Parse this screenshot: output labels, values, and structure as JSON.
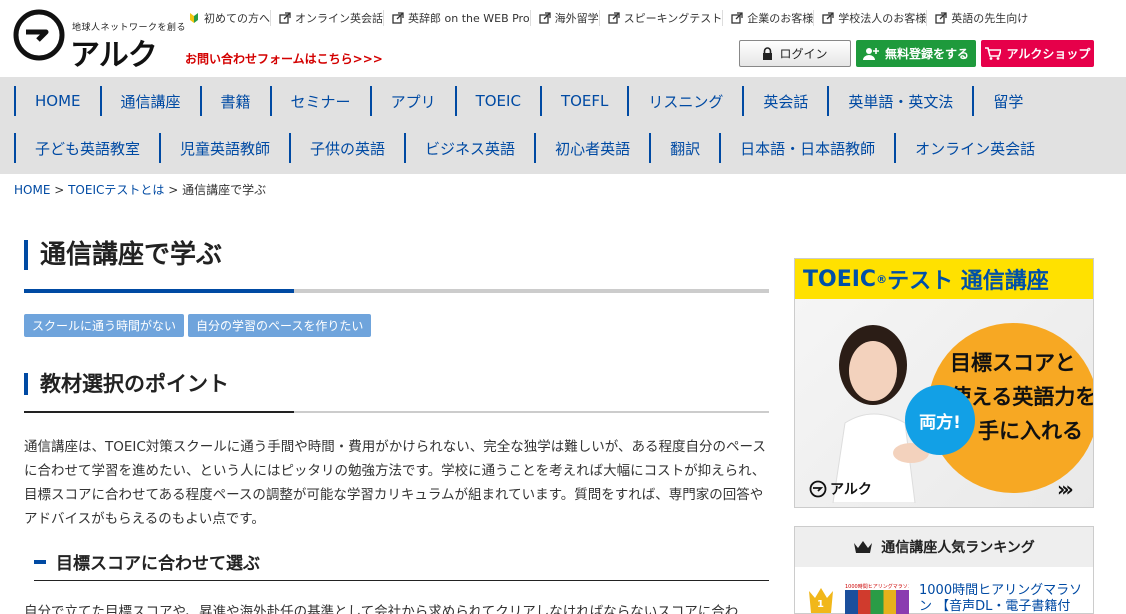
{
  "header": {
    "tagline": "地球人ネットワークを創る",
    "brand": "アルク",
    "contact_link": "お問い合わせフォームはこちら>>>",
    "toplinks": [
      {
        "label": "初めての方へ",
        "icon": "beginner-icon"
      },
      {
        "label": "オンライン英会話",
        "icon": "external-link-icon"
      },
      {
        "label": "英辞郎 on the WEB Pro",
        "icon": "external-link-icon"
      },
      {
        "label": "海外留学",
        "icon": "external-link-icon"
      },
      {
        "label": "スピーキングテスト",
        "icon": "external-link-icon"
      },
      {
        "label": "企業のお客様",
        "icon": "external-link-icon"
      },
      {
        "label": "学校法人のお客様",
        "icon": "external-link-icon"
      },
      {
        "label": "英語の先生向け",
        "icon": "external-link-icon"
      }
    ],
    "login_label": "ログイン",
    "register_label": "無料登録をする",
    "shop_label": "アルクショップ"
  },
  "nav": {
    "row1": [
      "HOME",
      "通信講座",
      "書籍",
      "セミナー",
      "アプリ",
      "TOEIC",
      "TOEFL",
      "リスニング",
      "英会話",
      "英単語・英文法",
      "留学"
    ],
    "row2": [
      "子ども英語教室",
      "児童英語教師",
      "子供の英語",
      "ビジネス英語",
      "初心者英語",
      "翻訳",
      "日本語・日本語教師",
      "オンライン英会話"
    ]
  },
  "breadcrumb": {
    "home": "HOME",
    "sep1": " > ",
    "parent": "TOEICテストとは",
    "sep2": " > ",
    "current": "通信講座で学ぶ"
  },
  "main": {
    "title": "通信講座で学ぶ",
    "tags": [
      "スクールに通う時間がない",
      "自分の学習のペースを作りたい"
    ],
    "section_title": "教材選択のポイント",
    "paragraph": "通信講座は、TOEIC対策スクールに通う手間や時間・費用がかけられない、完全な独学は難しいが、ある程度自分のペースに合わせて学習を進めたい、という人にはピッタリの勉強方法です。学校に通うことを考えれば大幅にコストが抑えられ、目標スコアに合わせてある程度ペースの調整が可能な学習カリキュラムが組まれています。質問をすれば、専門家の回答やアドバイスがもらえるのもよい点です。",
    "subsection_title": "目標スコアに合わせて選ぶ",
    "paragraph2": "自分で立てた目標スコアや、昇進や海外赴任の基準として会社から求められてクリアしなければならないスコアに合わ"
  },
  "sidebar": {
    "banner": {
      "title_main": "TOEIC",
      "title_reg": "®",
      "title_rest": " テスト 通信講座",
      "line1": "目標スコアと",
      "line2": "使える英語力を",
      "line3": "手に入れる",
      "badge": "両方!",
      "logo": "アルク",
      "arrow": "›››"
    },
    "ranking": {
      "heading": "通信講座人気ランキング",
      "items": [
        {
          "rank": "1",
          "thumb_label": "1000時間ヒアリングマラソン",
          "title_line1": "1000時間ヒアリングマラソ",
          "title_line2": "ン 【音声DL・電子書籍付"
        }
      ]
    }
  },
  "colors": {
    "accent_blue": "#004aa3",
    "nav_bg": "#e1e1e1",
    "contact_red": "#d30000",
    "register_green": "#1e9a3c",
    "shop_pink": "#e6004a",
    "tag_blue": "#6fa4dc",
    "banner_yellow": "#ffe100",
    "banner_orange": "#f7a823",
    "banner_badge_blue": "#12a0e6"
  }
}
